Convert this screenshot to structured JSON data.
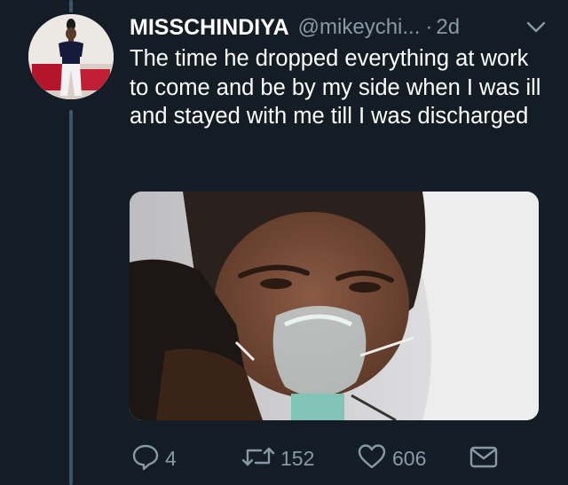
{
  "tweet": {
    "display_name": "MISSCHINDIYA",
    "handle": "@mikeychi...",
    "separator": "·",
    "time": "2d",
    "text": "The time he dropped everything at work to come and be by my side when I was ill and stayed with me till I was discharged",
    "media": {
      "type": "photo"
    }
  },
  "actions": {
    "reply_count": "4",
    "retweet_count": "152",
    "like_count": "606"
  },
  "colors": {
    "background": "#141d26",
    "text_primary": "#ffffff",
    "text_secondary": "#8899a6",
    "thread_line": "#3d5466"
  },
  "icons": [
    "chevron-down-icon",
    "reply-icon",
    "retweet-icon",
    "heart-icon",
    "direct-message-icon"
  ]
}
